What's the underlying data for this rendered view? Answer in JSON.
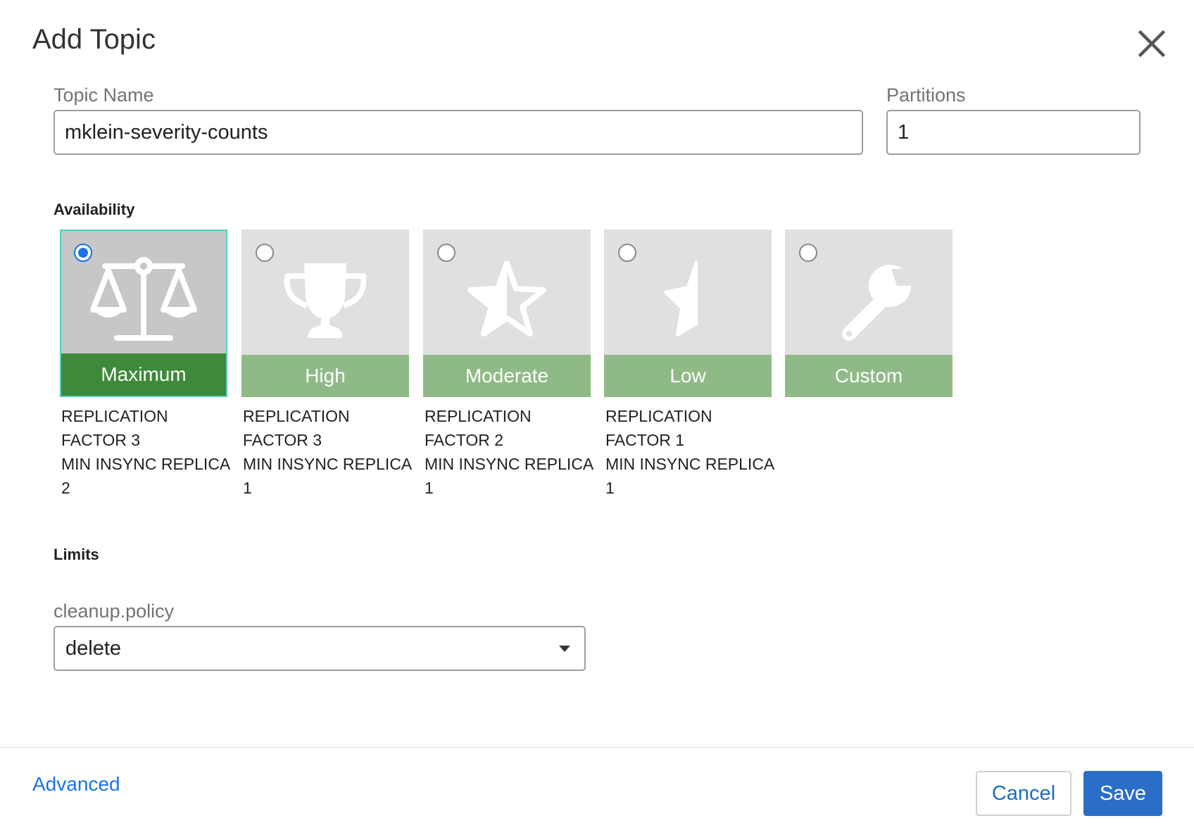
{
  "dialog": {
    "title": "Add Topic"
  },
  "topic_name": {
    "label": "Topic Name",
    "value": "mklein-severity-counts"
  },
  "partitions": {
    "label": "Partitions",
    "value": "1"
  },
  "availability": {
    "heading": "Availability",
    "selected": "Maximum",
    "options": [
      {
        "label": "Maximum",
        "icon": "balance-scale-icon",
        "desc": [
          "REPLICATION",
          "FACTOR 3",
          "MIN INSYNC REPLICA",
          "2"
        ]
      },
      {
        "label": "High",
        "icon": "trophy-icon",
        "desc": [
          "REPLICATION",
          "FACTOR 3",
          "MIN INSYNC REPLICA",
          "1"
        ]
      },
      {
        "label": "Moderate",
        "icon": "half-star-icon",
        "desc": [
          "REPLICATION",
          "FACTOR 2",
          "MIN INSYNC REPLICA",
          "1"
        ]
      },
      {
        "label": "Low",
        "icon": "star-fragment-icon",
        "desc": [
          "REPLICATION",
          "FACTOR 1",
          "MIN INSYNC REPLICA",
          "1"
        ]
      },
      {
        "label": "Custom",
        "icon": "wrench-icon",
        "desc": []
      }
    ]
  },
  "limits": {
    "heading": "Limits",
    "cleanup_policy": {
      "label": "cleanup.policy",
      "value": "delete"
    }
  },
  "footer": {
    "advanced": "Advanced",
    "cancel": "Cancel",
    "save": "Save"
  },
  "colors": {
    "selected_band": "#3e8a3a",
    "band": "#8fba87",
    "card": "#e0e0e0",
    "card_selected": "#c7c7c7",
    "accent": "#1a73e8",
    "save_button": "#2b6ec8"
  }
}
